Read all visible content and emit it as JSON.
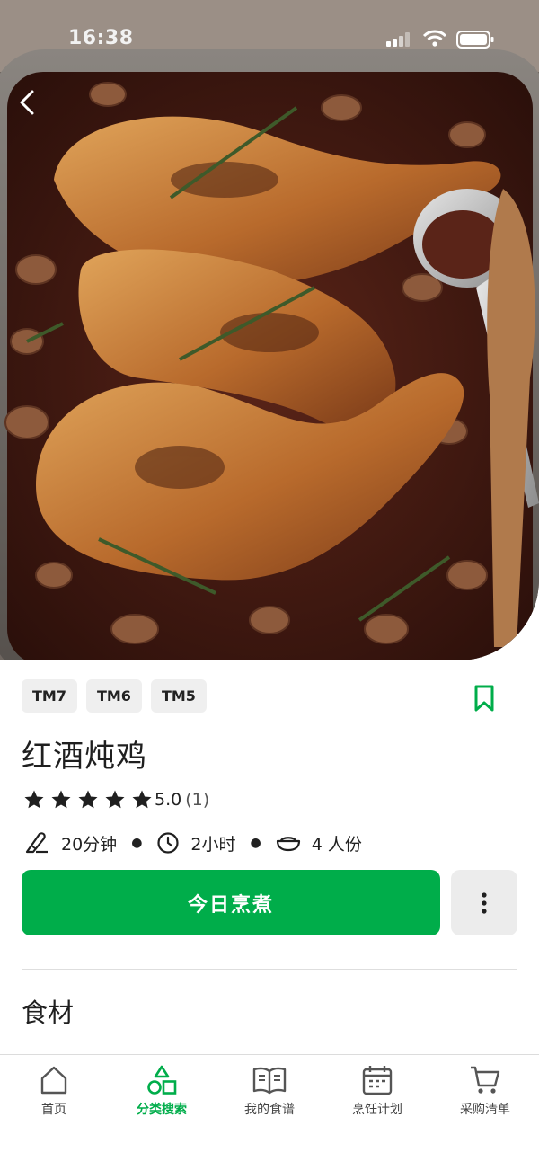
{
  "status_bar": {
    "time": "16:38"
  },
  "recipe": {
    "tags": [
      "TM7",
      "TM6",
      "TM5"
    ],
    "title": "红酒炖鸡",
    "rating": {
      "stars": 5,
      "score": "5.0",
      "count": "(1)"
    },
    "prep_time": "20分钟",
    "total_time": "2小时",
    "servings": "4 人份"
  },
  "actions": {
    "cook_today": "今日烹煮"
  },
  "sections": {
    "ingredients": "食材"
  },
  "tabbar": {
    "items": [
      {
        "label": "首页",
        "icon": "home-icon"
      },
      {
        "label": "分类搜索",
        "icon": "category-search-icon",
        "active": true
      },
      {
        "label": "我的食谱",
        "icon": "book-icon"
      },
      {
        "label": "烹饪计划",
        "icon": "calendar-icon"
      },
      {
        "label": "采购清单",
        "icon": "cart-icon"
      }
    ]
  },
  "colors": {
    "accent": "#00ad4a",
    "tag_bg": "#efefef",
    "star": "#1f1f1f"
  }
}
